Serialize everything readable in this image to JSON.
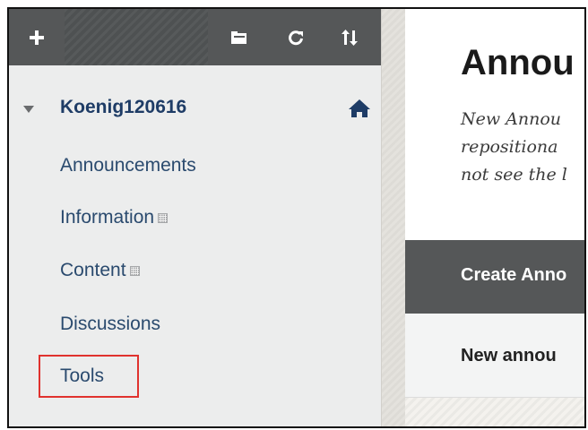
{
  "toolbar": {
    "add_icon": "plus-icon",
    "folder_icon": "folder-icon",
    "refresh_icon": "refresh-icon",
    "sort_icon": "sort-icon",
    "background_color": "#555758"
  },
  "course_menu": {
    "course_title": "Koenig120616",
    "home_icon": "home-icon",
    "items": [
      {
        "label": "Announcements",
        "hidden_indicator": false
      },
      {
        "label": "Information",
        "hidden_indicator": true
      },
      {
        "label": "Content",
        "hidden_indicator": true
      },
      {
        "label": "Discussions",
        "hidden_indicator": false
      },
      {
        "label": "Tools",
        "hidden_indicator": false,
        "highlighted": true
      }
    ],
    "link_color": "#2a4a6e",
    "highlight_color": "#e0322e"
  },
  "content": {
    "page_title": "Annou",
    "instructions": [
      "New Annou",
      "repositiona",
      "not see the l"
    ],
    "action_button": "Create Anno",
    "list_row_title": "New annou"
  }
}
